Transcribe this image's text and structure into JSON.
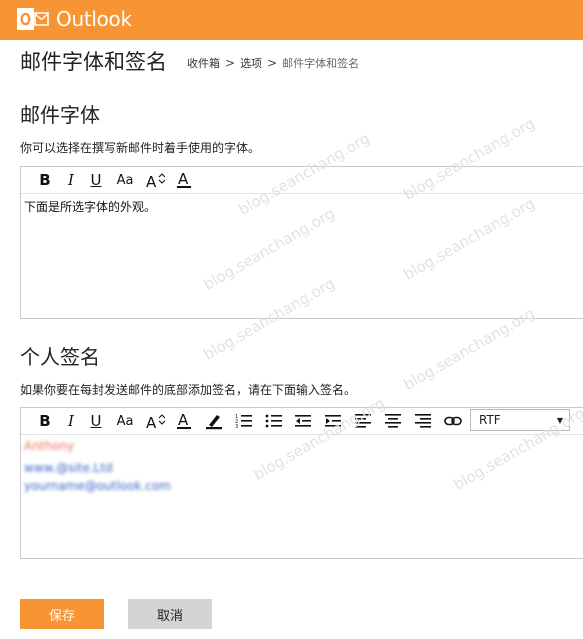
{
  "app": {
    "name": "Outlook",
    "brand_color": "#f79433"
  },
  "header": {
    "page_title": "邮件字体和签名",
    "breadcrumb": [
      "收件箱",
      "选项",
      "邮件字体和签名"
    ],
    "separator": ">"
  },
  "font_section": {
    "heading": "邮件字体",
    "description": "你可以选择在撰写新邮件时着手使用的字体。",
    "toolbar": [
      "bold-icon",
      "italic-icon",
      "underline-icon",
      "font-size-icon",
      "grow-font-icon",
      "font-color-icon"
    ],
    "toolbar_glyphs": {
      "bold": "B",
      "italic": "I",
      "underline": "U",
      "size": "Aa",
      "grow": "A"
    },
    "preview_text": "下面是所选字体的外观。"
  },
  "signature_section": {
    "heading": "个人签名",
    "description": "如果你要在每封发送邮件的底部添加签名，请在下面输入签名。",
    "format_select": "RTF",
    "toolbar": [
      "bold-icon",
      "italic-icon",
      "underline-icon",
      "font-size-icon",
      "grow-font-icon",
      "font-color-icon",
      "highlight-icon",
      "numbered-list-icon",
      "bullet-list-icon",
      "decrease-indent-icon",
      "increase-indent-icon",
      "align-left-icon",
      "align-center-icon",
      "align-right-icon",
      "link-icon"
    ],
    "signature_lines": [
      {
        "text": "Anthony",
        "color": "#e8735a"
      },
      {
        "text": "www.@site.Ltd",
        "color": "#3b63c4"
      },
      {
        "text": "yourname@outlook.com",
        "color": "#3b63c4"
      }
    ]
  },
  "buttons": {
    "save": "保存",
    "cancel": "取消"
  },
  "watermark": "blog.seanchang.org"
}
